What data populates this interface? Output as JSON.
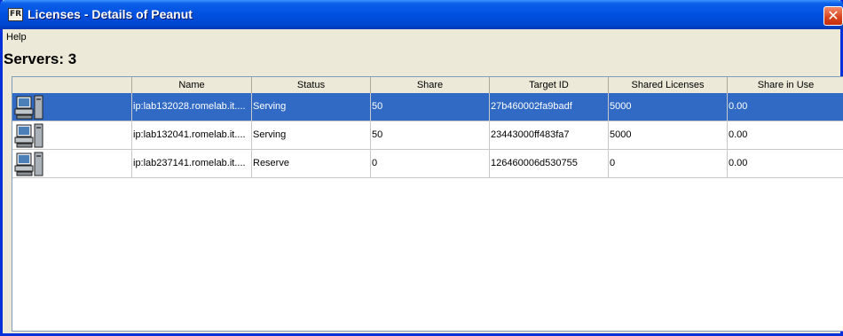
{
  "window": {
    "title": "Licenses - Details of Peanut",
    "app_icon_text": "FR",
    "close_glyph": "✕"
  },
  "menu": {
    "items": [
      "Help"
    ]
  },
  "heading": "Servers: 3",
  "table": {
    "columns": [
      "",
      "Name",
      "Status",
      "Share",
      "Target ID",
      "Shared Licenses",
      "Share in Use"
    ],
    "rows": [
      {
        "icon": "server-computer-icon",
        "name": "ip:lab132028.romelab.it....",
        "status": "Serving",
        "share": "50",
        "target_id": "27b460002fa9badf",
        "shared_licenses": "5000",
        "share_in_use": "0.00",
        "selected": true
      },
      {
        "icon": "server-computer-icon",
        "name": "ip:lab132041.romelab.it....",
        "status": "Serving",
        "share": "50",
        "target_id": "23443000ff483fa7",
        "shared_licenses": "5000",
        "share_in_use": "0.00",
        "selected": false
      },
      {
        "icon": "server-computer-icon",
        "name": "ip:lab237141.romelab.it....",
        "status": "Reserve",
        "share": "0",
        "target_id": "126460006d530755",
        "shared_licenses": "0",
        "share_in_use": "0.00",
        "selected": false
      }
    ]
  },
  "colors": {
    "selection": "#316ac5",
    "titlebar": "#0050e0",
    "close_button": "#d8431c"
  }
}
